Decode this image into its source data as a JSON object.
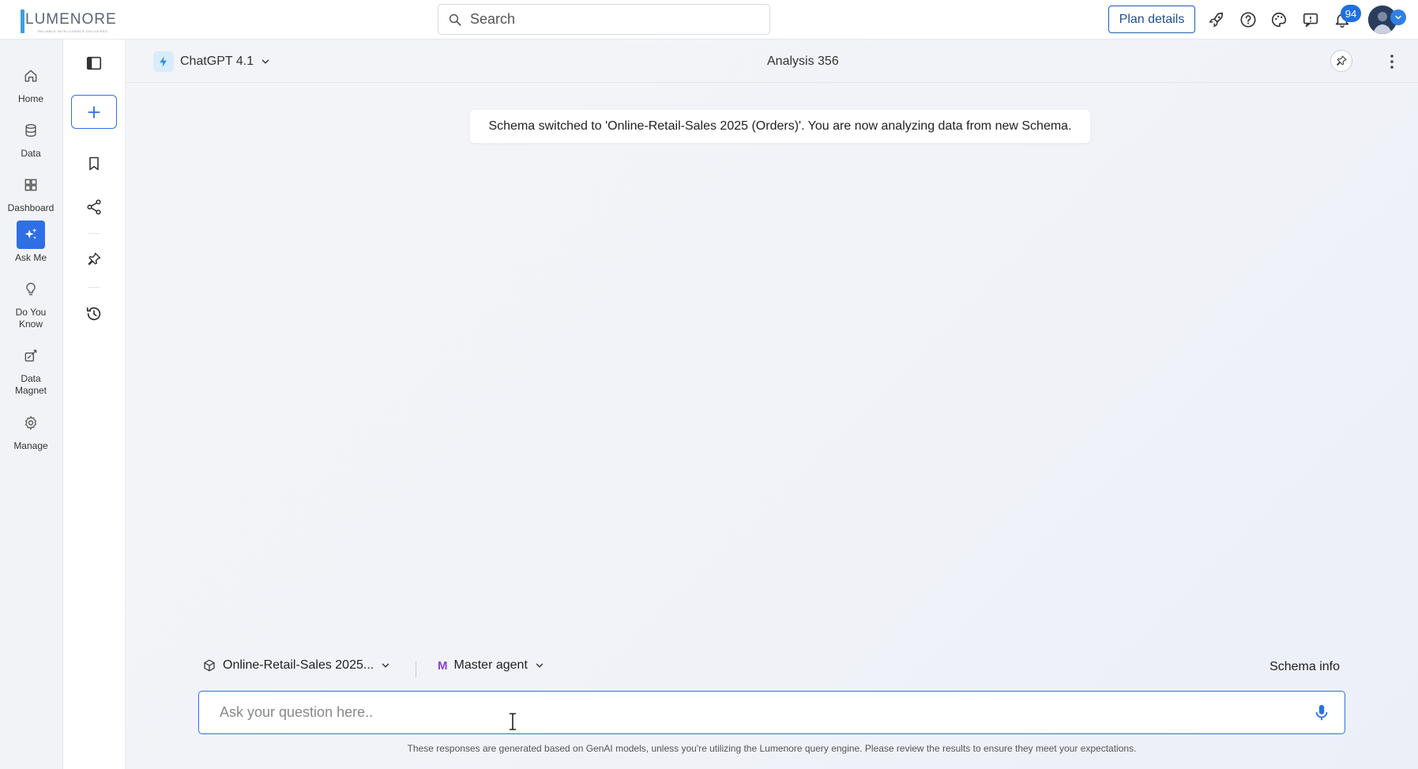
{
  "brand": {
    "logo_text": "LUMENORE",
    "tagline": "RELIABLE INTELLIGENCE DELIVERED"
  },
  "topbar": {
    "search_placeholder": "Search",
    "plan_details_label": "Plan details",
    "notification_count": "94",
    "icons": [
      "rocket-icon",
      "help-icon",
      "palette-icon",
      "feedback-icon",
      "bell-icon"
    ]
  },
  "leftnav": {
    "items": [
      {
        "label": "Home",
        "icon": "home-icon"
      },
      {
        "label": "Data",
        "icon": "database-icon"
      },
      {
        "label": "Dashboard",
        "icon": "dashboard-icon"
      },
      {
        "label": "Ask Me",
        "icon": "sparkle-icon",
        "active": true
      },
      {
        "label": "Do You Know",
        "icon": "bulb-icon"
      },
      {
        "label": "Data Magnet",
        "icon": "magnet-icon"
      },
      {
        "label": "Manage",
        "icon": "gear-icon"
      }
    ]
  },
  "toolcol": {
    "icons": [
      "panel-toggle-icon",
      "plus-icon",
      "bookmark-icon",
      "share-icon",
      "pin-icon",
      "history-icon"
    ]
  },
  "header": {
    "model_name": "ChatGPT 4.1",
    "analysis_title": "Analysis 356"
  },
  "notice": {
    "text": "Schema switched to 'Online-Retail-Sales 2025 (Orders)'. You are now analyzing data from new Schema."
  },
  "composer": {
    "schema_label": "Online-Retail-Sales 2025...",
    "agent_initial": "M",
    "agent_label": "Master agent",
    "schema_info_label": "Schema info",
    "input_placeholder": "Ask your question here.."
  },
  "disclaimer": "These responses are generated based on GenAI models, unless you're utilizing the Lumenore query engine. Please review the results to ensure they meet your expectations.",
  "colors": {
    "accent": "#2f6fe6",
    "plan_border": "#1f5fa8",
    "agent_m": "#8a3fd6"
  }
}
